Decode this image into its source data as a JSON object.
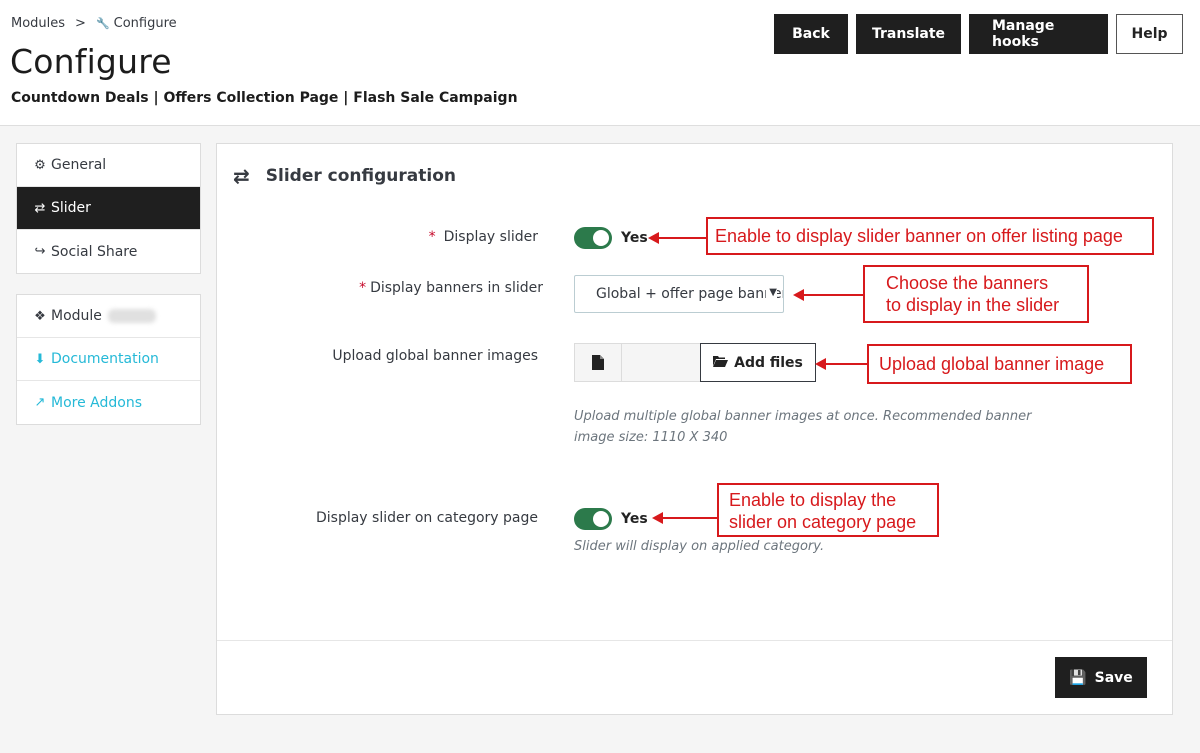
{
  "breadcrumb": {
    "modules": "Modules",
    "separator": ">",
    "current": "Configure",
    "current_icon": "wrench-icon"
  },
  "header": {
    "title": "Configure",
    "subtitle": "Countdown Deals | Offers Collection Page | Flash Sale Campaign"
  },
  "toolbar": {
    "back": "Back",
    "translate": "Translate",
    "manage_hooks": "Manage hooks",
    "help": "Help"
  },
  "sidebar": {
    "tabs": [
      {
        "label": "General",
        "icon": "gear-icon",
        "active": false
      },
      {
        "label": "Slider",
        "icon": "exchange-icon",
        "active": true
      },
      {
        "label": "Social Share",
        "icon": "share-icon",
        "active": false
      }
    ],
    "links": [
      {
        "label": "Module",
        "icon": "puzzle-icon"
      },
      {
        "label": "Documentation",
        "icon": "download-circle-icon"
      },
      {
        "label": "More Addons",
        "icon": "external-link-icon"
      }
    ]
  },
  "panel": {
    "title": "Slider configuration",
    "title_icon": "exchange-icon",
    "display_slider": {
      "required": "*",
      "label": "Display slider",
      "value": "Yes",
      "enabled": true
    },
    "display_banners": {
      "required": "*",
      "label": "Display banners in slider",
      "value": "Global + offer page banners"
    },
    "upload": {
      "label": "Upload global banner images",
      "button": "Add files",
      "help_line1": "Upload multiple global banner images at once. Recommended banner",
      "help_line2": "image size: 1110 X 340"
    },
    "category_slider": {
      "label": "Display slider on category page",
      "value": "Yes",
      "enabled": true,
      "help": "Slider will display on applied category."
    },
    "save": "Save"
  },
  "annotations": {
    "display_slider": "Enable to display slider banner on offer listing page",
    "banners_line1": "Choose the banners",
    "banners_line2": "to display in the slider",
    "upload": "Upload global banner image",
    "category_line1": "Enable to display the",
    "category_line2": "slider on category page"
  },
  "colors": {
    "accent_dark": "#1f1f1f",
    "switch_on": "#2c7a4b",
    "link": "#25b9d7",
    "annotation": "#d7191c"
  }
}
